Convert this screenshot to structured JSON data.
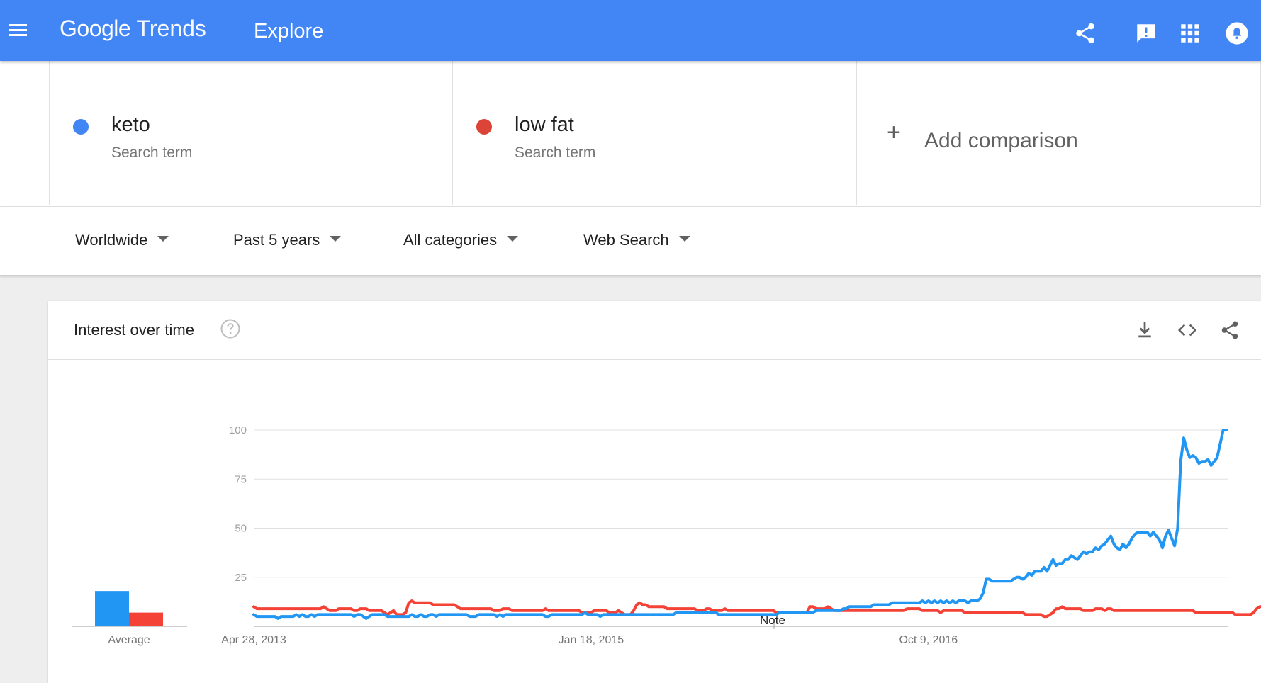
{
  "header": {
    "logo_google": "Google",
    "logo_trends": "Trends",
    "title": "Explore",
    "bar_color": "#4285f4",
    "icons": [
      "menu-icon",
      "share-icon",
      "feedback-icon",
      "apps-icon",
      "notifications-icon"
    ]
  },
  "terms": [
    {
      "name": "keto",
      "type": "Search term",
      "color": "#4285f4"
    },
    {
      "name": "low fat",
      "type": "Search term",
      "color": "#db4437"
    }
  ],
  "add_comparison": {
    "symbol": "+",
    "label": "Add comparison"
  },
  "filters": {
    "region": "Worldwide",
    "time": "Past 5 years",
    "category": "All categories",
    "property": "Web Search"
  },
  "card": {
    "title": "Interest over time",
    "icons": [
      "help-icon",
      "download-icon",
      "embed-code-icon",
      "share-icon"
    ]
  },
  "chart_data": {
    "type": "line",
    "title": "Interest over time",
    "ylim": [
      0,
      100
    ],
    "yticks": [
      25,
      50,
      75,
      100
    ],
    "xtick_labels": [
      "Apr 28, 2013",
      "Jan 18, 2015",
      "Oct 9, 2016"
    ],
    "x_start": "Apr 28, 2013",
    "grid": true,
    "annotation": "Note",
    "average_label": "Average",
    "series": [
      {
        "name": "keto",
        "color": "#2196f3",
        "average": 18,
        "values": [
          6,
          5,
          5,
          5,
          5,
          5,
          5,
          5,
          4,
          5,
          5,
          5,
          5,
          5,
          6,
          5,
          6,
          5,
          5,
          6,
          5,
          6,
          6,
          6,
          6,
          6,
          6,
          6,
          6,
          6,
          6,
          6,
          6,
          5,
          6,
          6,
          5,
          4,
          5,
          6,
          6,
          6,
          6,
          6,
          5,
          5,
          5,
          5,
          5,
          5,
          5,
          5,
          6,
          5,
          5,
          6,
          5,
          5,
          6,
          6,
          5,
          6,
          6,
          6,
          6,
          6,
          6,
          6,
          6,
          6,
          6,
          5,
          5,
          5,
          6,
          6,
          6,
          6,
          6,
          6,
          5,
          6,
          5,
          6,
          6,
          6,
          6,
          6,
          6,
          6,
          6,
          6,
          6,
          6,
          6,
          6,
          5,
          5,
          6,
          6,
          6,
          6,
          6,
          6,
          6,
          6,
          6,
          6,
          6,
          7,
          6,
          6,
          6,
          6,
          5,
          6,
          6,
          6,
          6,
          6,
          6,
          6,
          6,
          6,
          6,
          6,
          6,
          6,
          6,
          6,
          6,
          6,
          6,
          6,
          6,
          6,
          6,
          6,
          6,
          7,
          7,
          7,
          7,
          7,
          7,
          7,
          7,
          7,
          7,
          7,
          7,
          7,
          7,
          6,
          6,
          6,
          6,
          6,
          6,
          6,
          6,
          6,
          6,
          6,
          6,
          6,
          6,
          6,
          6,
          6,
          6,
          6,
          6,
          7,
          7,
          7,
          7,
          7,
          7,
          7,
          7,
          7,
          7,
          7,
          7,
          8,
          8,
          8,
          8,
          8,
          8,
          8,
          8,
          8,
          9,
          9,
          10,
          10,
          10,
          10,
          10,
          10,
          10,
          10,
          11,
          11,
          11,
          11,
          11,
          11,
          12,
          12,
          12,
          12,
          12,
          12,
          12,
          12,
          12,
          12,
          13,
          12,
          13,
          12,
          13,
          12,
          13,
          12,
          13,
          12,
          13,
          12,
          13,
          13,
          13,
          12,
          13,
          13,
          13,
          14,
          17,
          24,
          24,
          23,
          23,
          23,
          23,
          23,
          23,
          23,
          24,
          25,
          25,
          24,
          25,
          27,
          26,
          28,
          28,
          28,
          30,
          28,
          31,
          34,
          31,
          32,
          32,
          34,
          34,
          36,
          35,
          34,
          36,
          38,
          37,
          38,
          38,
          40,
          39,
          41,
          42,
          44,
          46,
          42,
          40,
          39,
          42,
          40,
          42,
          45,
          47,
          48,
          48,
          48,
          48,
          46,
          48,
          46,
          44,
          40,
          46,
          49,
          45,
          41,
          50,
          84,
          96,
          90,
          86,
          87,
          86,
          83,
          84,
          84,
          85,
          82,
          84,
          86,
          93,
          100,
          100
        ]
      },
      {
        "name": "low fat",
        "color": "#f44336",
        "average": 7,
        "values": [
          10,
          9,
          9,
          9,
          9,
          9,
          9,
          9,
          9,
          9,
          9,
          9,
          9,
          9,
          9,
          9,
          9,
          9,
          9,
          9,
          9,
          9,
          9,
          10,
          9,
          8,
          8,
          8,
          9,
          9,
          9,
          9,
          9,
          8,
          8,
          9,
          9,
          9,
          8,
          8,
          8,
          8,
          8,
          7,
          6,
          7,
          8,
          6,
          6,
          6,
          7,
          12,
          13,
          12,
          12,
          12,
          12,
          12,
          12,
          11,
          11,
          11,
          11,
          11,
          11,
          11,
          11,
          10,
          9,
          9,
          9,
          9,
          9,
          9,
          9,
          9,
          9,
          9,
          9,
          8,
          8,
          8,
          9,
          9,
          9,
          8,
          8,
          8,
          8,
          8,
          8,
          8,
          8,
          8,
          8,
          8,
          9,
          8,
          8,
          8,
          8,
          8,
          8,
          8,
          8,
          8,
          8,
          8,
          7,
          7,
          7,
          7,
          8,
          8,
          8,
          8,
          8,
          7,
          7,
          7,
          8,
          7,
          6,
          6,
          6,
          8,
          11,
          12,
          11,
          11,
          10,
          10,
          10,
          10,
          10,
          10,
          9,
          9,
          9,
          9,
          9,
          9,
          9,
          9,
          9,
          9,
          8,
          8,
          8,
          9,
          9,
          8,
          8,
          8,
          8,
          9,
          8,
          8,
          8,
          8,
          8,
          8,
          8,
          8,
          8,
          8,
          8,
          8,
          8,
          8,
          8,
          8,
          7,
          7,
          7,
          7,
          7,
          7,
          7,
          7,
          7,
          7,
          7,
          10,
          10,
          9,
          9,
          9,
          9,
          10,
          9,
          8,
          8,
          8,
          8,
          8,
          8,
          8,
          8,
          8,
          8,
          8,
          8,
          8,
          8,
          8,
          8,
          8,
          8,
          8,
          8,
          8,
          8,
          8,
          8,
          9,
          9,
          9,
          9,
          9,
          8,
          8,
          8,
          8,
          8,
          8,
          7,
          8,
          8,
          8,
          8,
          8,
          8,
          8,
          7,
          7,
          7,
          7,
          7,
          7,
          7,
          7,
          7,
          7,
          7,
          7,
          7,
          7,
          7,
          7,
          7,
          7,
          7,
          7,
          6,
          6,
          6,
          6,
          6,
          6,
          5,
          5,
          6,
          7,
          9,
          9,
          10,
          9,
          9,
          9,
          9,
          9,
          9,
          8,
          8,
          8,
          8,
          9,
          9,
          9,
          8,
          9,
          9,
          8,
          8,
          8,
          8,
          8,
          8,
          8,
          8,
          8,
          8,
          8,
          8,
          8,
          8,
          8,
          8,
          8,
          8,
          8,
          8,
          8,
          8,
          8,
          8,
          8,
          8,
          8,
          7,
          7,
          7,
          7,
          7,
          7,
          7,
          7,
          7,
          7,
          7,
          7,
          7,
          6,
          6,
          6,
          6,
          6,
          6,
          7,
          9,
          10,
          10,
          10,
          10,
          10,
          10,
          9,
          8,
          9,
          9,
          9,
          9,
          8,
          8,
          8,
          8,
          8,
          8,
          9,
          9,
          9,
          9
        ]
      }
    ]
  }
}
